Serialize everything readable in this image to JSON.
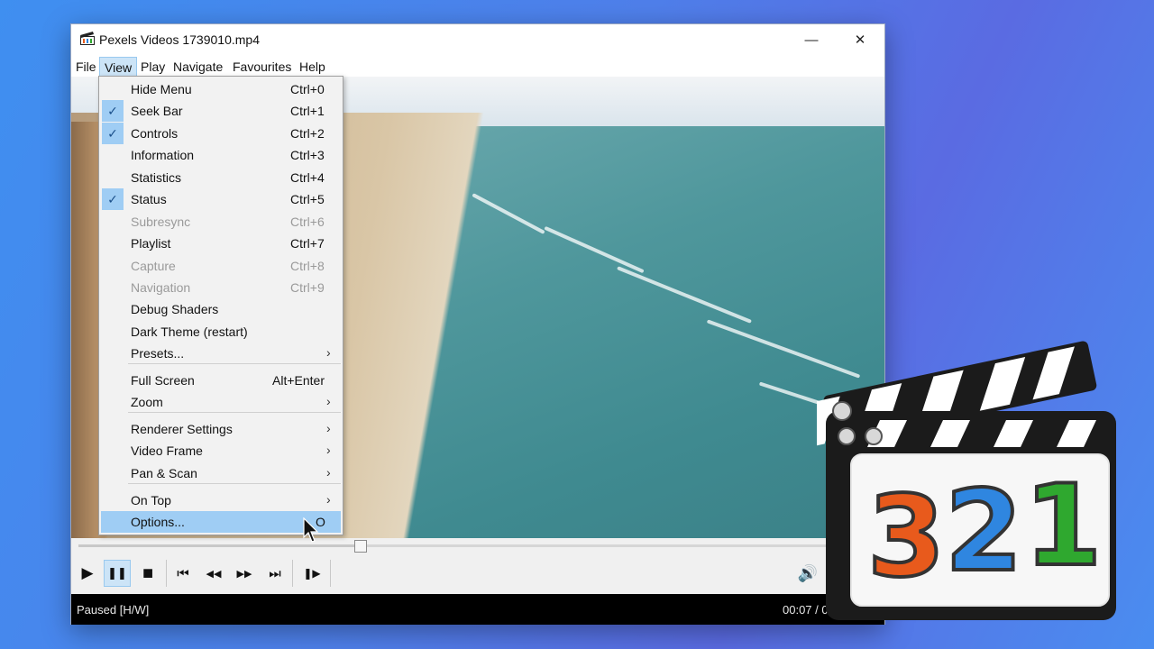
{
  "window": {
    "title": "Pexels Videos 1739010.mp4",
    "controls": {
      "minimize": "—",
      "maximize": "☐",
      "close": "✕"
    }
  },
  "menubar": [
    "File",
    "View",
    "Play",
    "Navigate",
    "Favourites",
    "Help"
  ],
  "view_menu": {
    "items": [
      {
        "label": "Hide Menu",
        "shortcut": "Ctrl+0",
        "checked": false,
        "disabled": false
      },
      {
        "label": "Seek Bar",
        "shortcut": "Ctrl+1",
        "checked": true,
        "disabled": false
      },
      {
        "label": "Controls",
        "shortcut": "Ctrl+2",
        "checked": true,
        "disabled": false
      },
      {
        "label": "Information",
        "shortcut": "Ctrl+3",
        "checked": false,
        "disabled": false
      },
      {
        "label": "Statistics",
        "shortcut": "Ctrl+4",
        "checked": false,
        "disabled": false
      },
      {
        "label": "Status",
        "shortcut": "Ctrl+5",
        "checked": true,
        "disabled": false
      },
      {
        "label": "Subresync",
        "shortcut": "Ctrl+6",
        "checked": false,
        "disabled": true
      },
      {
        "label": "Playlist",
        "shortcut": "Ctrl+7",
        "checked": false,
        "disabled": false
      },
      {
        "label": "Capture",
        "shortcut": "Ctrl+8",
        "checked": false,
        "disabled": true
      },
      {
        "label": "Navigation",
        "shortcut": "Ctrl+9",
        "checked": false,
        "disabled": true
      },
      {
        "label": "Debug Shaders",
        "shortcut": "",
        "checked": false,
        "disabled": false
      },
      {
        "label": "Dark Theme (restart)",
        "shortcut": "",
        "checked": false,
        "disabled": false
      },
      {
        "label": "Presets...",
        "submenu": true
      },
      {
        "label": "Full Screen",
        "shortcut": "Alt+Enter"
      },
      {
        "label": "Zoom",
        "submenu": true
      },
      {
        "label": "Renderer Settings",
        "submenu": true
      },
      {
        "label": "Video Frame",
        "submenu": true
      },
      {
        "label": "Pan & Scan",
        "submenu": true
      },
      {
        "label": "On Top",
        "submenu": true
      },
      {
        "label": "Options...",
        "shortcut": "O",
        "highlighted": true
      }
    ],
    "check_glyph": "✓",
    "submenu_glyph": "›"
  },
  "playback": {
    "progress": 0.36,
    "buttons": {
      "play": "▶",
      "pause": "❚❚",
      "stop": "■",
      "prev": "⏮",
      "rewind": "◀◀",
      "forward": "▶▶",
      "next": "⏭",
      "frame_step": "❚▶",
      "volume": "🔊"
    }
  },
  "status": {
    "state": "Paused [H/W]",
    "time": "00:07 / 00:20"
  },
  "logo": {
    "digits": [
      "3",
      "2",
      "1"
    ],
    "colors": [
      "#e85a1c",
      "#2f86e0",
      "#2fa82f"
    ]
  },
  "icons": [
    "app-clapper-icon",
    "mouse-cursor-icon",
    "speaker-icon"
  ]
}
